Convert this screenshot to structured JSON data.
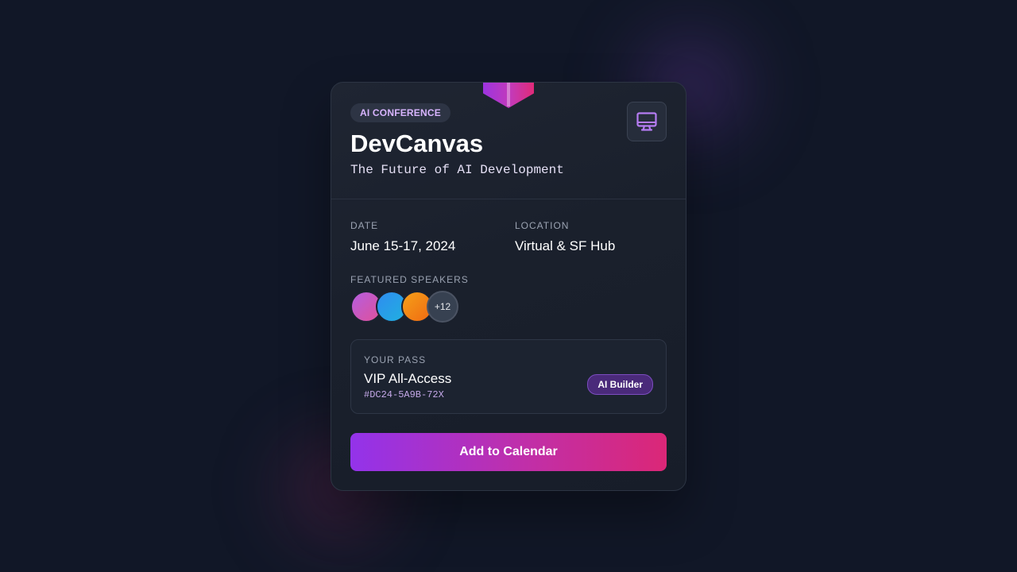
{
  "event": {
    "badge": "AI CONFERENCE",
    "title": "DevCanvas",
    "subtitle": "The Future of AI Development",
    "icon": "monitor-icon"
  },
  "details": {
    "date_label": "DATE",
    "date_value": "June 15-17, 2024",
    "location_label": "LOCATION",
    "location_value": "Virtual & SF Hub"
  },
  "speakers": {
    "label": "FEATURED SPEAKERS",
    "more_count": "+12"
  },
  "pass": {
    "label": "YOUR PASS",
    "name": "VIP All-Access",
    "code": "#DC24-5A9B-72X",
    "tag": "AI Builder"
  },
  "cta": {
    "label": "Add to Calendar"
  },
  "colors": {
    "accent_purple": "#9333ea",
    "accent_pink": "#db2777",
    "background": "#111727"
  }
}
